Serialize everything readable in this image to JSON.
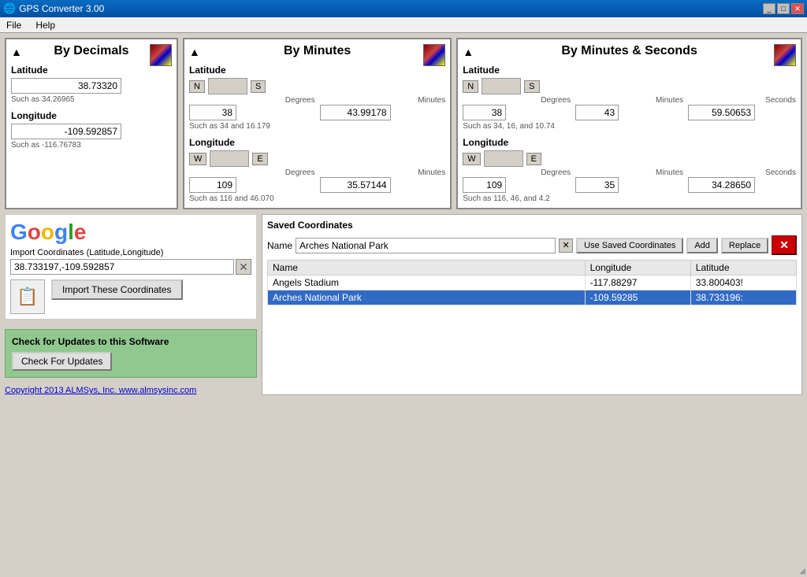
{
  "titlebar": {
    "title": "GPS Converter 3.00",
    "icon": "🌐",
    "minimize_label": "_",
    "maximize_label": "□",
    "close_label": "✕"
  },
  "menu": {
    "file_label": "File",
    "help_label": "Help"
  },
  "by_decimals": {
    "title": "By Decimals",
    "collapse_arrow": "▲",
    "latitude_label": "Latitude",
    "latitude_value": "38.73320",
    "latitude_hint": "Such as 34.26965",
    "longitude_label": "Longitude",
    "longitude_value": "-109.592857",
    "longitude_hint": "Such as -116.76783"
  },
  "by_minutes": {
    "title": "By Minutes",
    "collapse_arrow": "▲",
    "latitude_label": "Latitude",
    "lat_n": "N",
    "lat_s": "S",
    "lat_degrees_label": "Degrees",
    "lat_degrees_value": "38",
    "lat_minutes_label": "Minutes",
    "lat_minutes_value": "43.99178",
    "latitude_hint": "Such as 34 and 16.179",
    "longitude_label": "Longitude",
    "lon_w": "W",
    "lon_e": "E",
    "lon_degrees_label": "Degrees",
    "lon_degrees_value": "109",
    "lon_minutes_label": "Minutes",
    "lon_minutes_value": "35.57144",
    "longitude_hint": "Such as 116 and 46.070"
  },
  "by_minutes_seconds": {
    "title": "By Minutes & Seconds",
    "collapse_arrow": "▲",
    "latitude_label": "Latitude",
    "lat_n": "N",
    "lat_s": "S",
    "lat_degrees_label": "Degrees",
    "lat_degrees_value": "38",
    "lat_minutes_label": "Minutes",
    "lat_minutes_value": "43",
    "lat_seconds_label": "Seconds",
    "lat_seconds_value": "59.50653",
    "latitude_hint": "Such as 34, 16, and 10.74",
    "longitude_label": "Longitude",
    "lon_w": "W",
    "lon_e": "E",
    "lon_degrees_label": "Degrees",
    "lon_degrees_value": "109",
    "lon_minutes_label": "Minutes",
    "lon_minutes_value": "35",
    "lon_seconds_label": "Seconds",
    "lon_seconds_value": "34.28650",
    "longitude_hint": "Such as 116, 46, and 4.2"
  },
  "google": {
    "logo": "Google",
    "import_label": "Import Coordinates (Latitude,Longitude)",
    "import_value": "38.733197,-109.592857",
    "import_placeholder": "",
    "import_button_label": "Import These Coordinates",
    "paste_icon": "📋"
  },
  "update": {
    "title": "Check for Updates to this Software",
    "button_label": "Check For Updates"
  },
  "copyright": {
    "text": "Copyright 2013 ALMSys, Inc. www.almsysinc.com"
  },
  "saved_coords": {
    "title": "Saved Coordinates",
    "name_label": "Name",
    "name_value": "Arches National Park",
    "use_saved_btn": "Use Saved Coordinates",
    "add_btn": "Add",
    "replace_btn": "Replace",
    "delete_btn": "✕",
    "columns": [
      "Name",
      "Longitude",
      "Latitude"
    ],
    "rows": [
      {
        "name": "Angels Stadium",
        "longitude": "-117.88297",
        "latitude": "33.800403!"
      },
      {
        "name": "Arches National Park",
        "longitude": "-109.59285",
        "latitude": "38.733196:"
      }
    ],
    "selected_row": 1
  }
}
